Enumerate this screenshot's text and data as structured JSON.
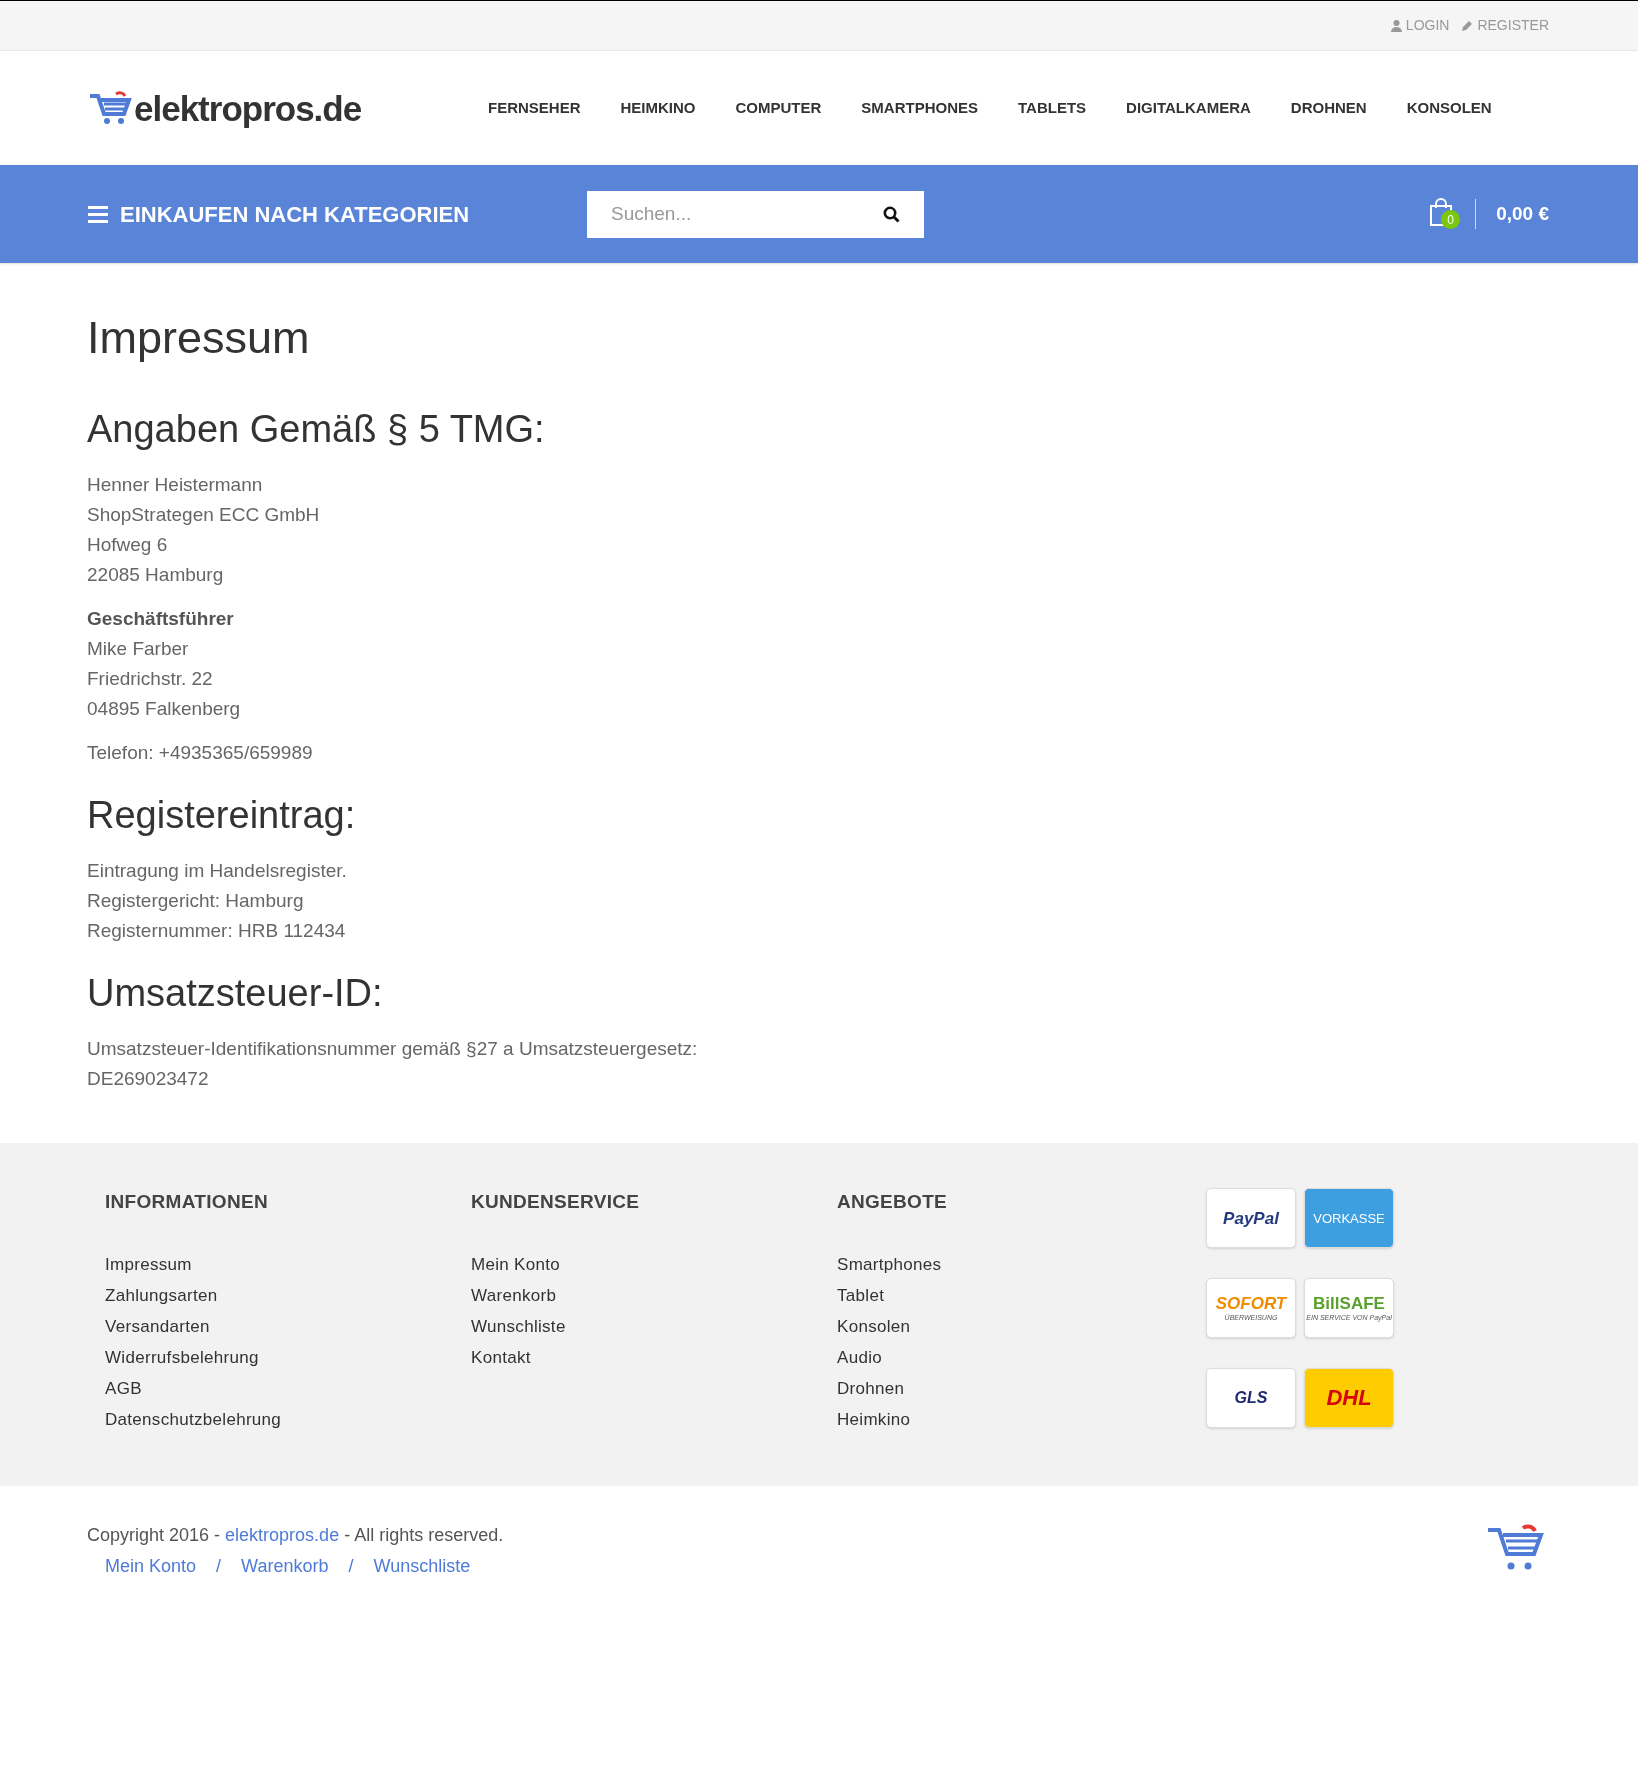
{
  "top_links": [
    {
      "kind": "user",
      "label": "LOGIN"
    },
    {
      "kind": "pencil",
      "label": "REGISTER"
    }
  ],
  "logo": {
    "text": "elektropros.de"
  },
  "nav": [
    "FERNSEHER",
    "HEIMKINO",
    "COMPUTER",
    "SMARTPHONES",
    "TABLETS",
    "DIGITALKAMERA",
    "DROHNEN",
    "KONSOLEN"
  ],
  "category_button": "EINKAUFEN NACH KATEGORIEN",
  "search": {
    "placeholder": "Suchen..."
  },
  "cart": {
    "count": "0",
    "total": "0,00 €"
  },
  "content": {
    "title": "Impressum",
    "sections": [
      {
        "heading": "Angaben Gemäß § 5 TMG:",
        "blocks": [
          {
            "lines": [
              "Henner Heistermann",
              "ShopStrategen ECC GmbH",
              "Hofweg 6",
              "22085 Hamburg"
            ]
          },
          {
            "label": "Geschäftsführer",
            "lines": [
              "Mike Farber",
              "Friedrichstr. 22",
              "04895 Falkenberg"
            ]
          },
          {
            "lines": [
              "Telefon: +4935365/659989"
            ]
          }
        ]
      },
      {
        "heading": "Registereintrag:",
        "blocks": [
          {
            "lines": [
              "Eintragung im Handelsregister.",
              "Registergericht: Hamburg",
              "Registernummer: HRB 112434"
            ]
          }
        ]
      },
      {
        "heading": "Umsatzsteuer-ID:",
        "blocks": [
          {
            "lines": [
              "Umsatzsteuer-Identifikationsnummer gemäß §27 a Umsatzsteuergesetz:",
              "DE269023472"
            ]
          }
        ]
      }
    ]
  },
  "footer_columns": [
    {
      "title": "INFORMATIONEN",
      "links": [
        "Impressum",
        "Zahlungsarten",
        "Versandarten",
        "Widerrufsbelehrung",
        "AGB",
        "Datenschutzbelehrung"
      ]
    },
    {
      "title": "KUNDENSERVICE",
      "links": [
        "Mein Konto",
        "Warenkorb",
        "Wunschliste",
        "Kontakt"
      ]
    },
    {
      "title": "ANGEBOTE",
      "links": [
        "Smartphones",
        "Tablet",
        "Konsolen",
        "Audio",
        "Drohnen",
        "Heimkino"
      ]
    }
  ],
  "payments": [
    {
      "kind": "paypal",
      "text": "PayPal"
    },
    {
      "kind": "vorkasse",
      "text": "VORKASSE"
    },
    {
      "kind": "sofort",
      "text": "SOFORT",
      "subtext": "ÜBERWEISUNG"
    },
    {
      "kind": "billsafe",
      "text": "BillSAFE",
      "subtext": "EIN SERVICE VON PayPal"
    },
    {
      "kind": "gls",
      "text": "GLS"
    },
    {
      "kind": "dhl",
      "text": "DHL"
    }
  ],
  "copyright": {
    "before": "Copyright 2016 - ",
    "link": "elektropros.de",
    "after": " - All rights reserved."
  },
  "bottom_links": [
    "Mein Konto",
    "Warenkorb",
    "Wunschliste"
  ],
  "separator": "/"
}
